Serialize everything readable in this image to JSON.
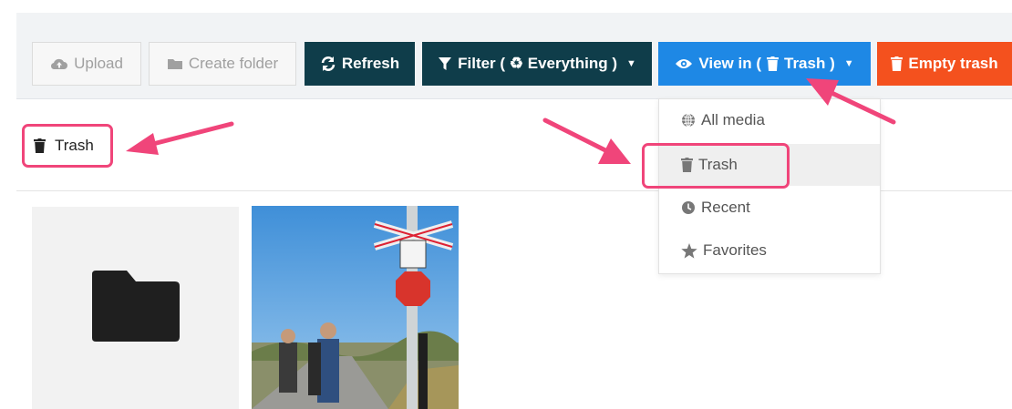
{
  "toolbar": {
    "upload_label": "Upload",
    "create_folder_label": "Create folder",
    "refresh_label": "Refresh",
    "filter_label": "Filter ( ♻ Everything )",
    "view_in_label": "View in (",
    "view_in_target": "Trash )",
    "empty_trash_label": "Empty trash"
  },
  "breadcrumb": {
    "label": "Trash"
  },
  "view_menu": {
    "items": [
      {
        "label": "All media",
        "icon": "globe-icon"
      },
      {
        "label": "Trash",
        "icon": "trash-icon",
        "selected": true
      },
      {
        "label": "Recent",
        "icon": "clock-icon"
      },
      {
        "label": "Favorites",
        "icon": "star-icon"
      }
    ]
  },
  "media": {
    "items": [
      {
        "type": "folder",
        "icon": "folder-icon"
      },
      {
        "type": "image"
      }
    ]
  },
  "colors": {
    "dark_button": "#0f3d4a",
    "view_button": "#1e88e5",
    "empty_trash_button": "#f4511e",
    "annotation": "#f0457a"
  }
}
